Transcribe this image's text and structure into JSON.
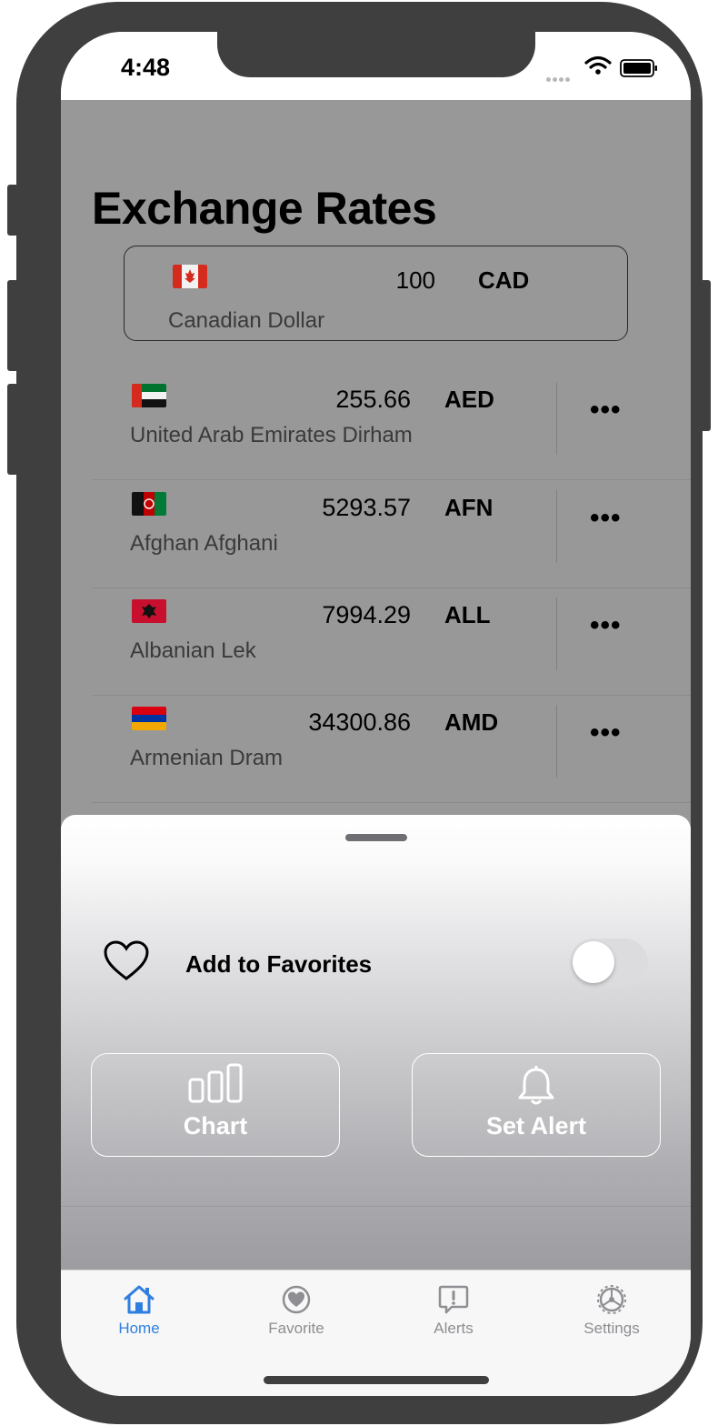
{
  "status_bar": {
    "time": "4:48"
  },
  "page": {
    "title": "Exchange Rates"
  },
  "base_currency": {
    "amount": "100",
    "code": "CAD",
    "name": "Canadian Dollar"
  },
  "rates": [
    {
      "amount": "255.66",
      "code": "AED",
      "name": "United Arab Emirates Dirham"
    },
    {
      "amount": "5293.57",
      "code": "AFN",
      "name": "Afghan Afghani"
    },
    {
      "amount": "7994.29",
      "code": "ALL",
      "name": "Albanian Lek"
    },
    {
      "amount": "34300.86",
      "code": "AMD",
      "name": "Armenian Dram"
    }
  ],
  "more_label": "•••",
  "sheet": {
    "favorites_label": "Add to Favorites",
    "favorites_on": false,
    "chart_label": "Chart",
    "alert_label": "Set Alert"
  },
  "tabs": [
    {
      "label": "Home",
      "icon": "house-icon",
      "active": true
    },
    {
      "label": "Favorite",
      "icon": "heart-circle-icon",
      "active": false
    },
    {
      "label": "Alerts",
      "icon": "exclamation-bubble-icon",
      "active": false
    },
    {
      "label": "Settings",
      "icon": "gear-icon",
      "active": false
    }
  ],
  "colors": {
    "accent": "#2f7fe0",
    "inactive_tab": "#8e8e93",
    "dim_background": "#989898"
  }
}
